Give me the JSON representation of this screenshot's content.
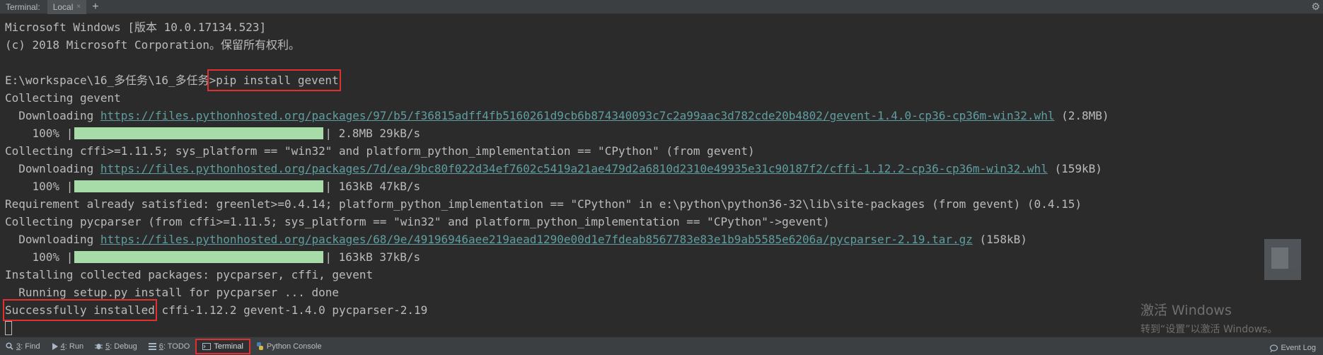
{
  "tabbar": {
    "label": "Terminal:",
    "tab_label": "Local",
    "close_glyph": "×",
    "add_glyph": "+",
    "gear_glyph": "⚙"
  },
  "terminal": {
    "lines": {
      "l1": "Microsoft Windows [版本 10.0.17134.523]",
      "l2": "(c) 2018 Microsoft Corporation。保留所有权利。",
      "prompt": "E:\\workspace\\16_多任务\\16_多任务",
      "command": ">pip install gevent",
      "l5": "Collecting gevent",
      "dl1_prefix": "  Downloading ",
      "dl1_url": "https://files.pythonhosted.org/packages/97/b5/f36815adff4fb5160261d9cb6b874340093c7c2a99aac3d782cde20b4802/gevent-1.4.0-cp36-cp36m-win32.whl",
      "dl1_size": " (2.8MB)",
      "p1_pct": "    100% |",
      "p1_rest": "| 2.8MB 29kB/s",
      "l8": "Collecting cffi>=1.11.5; sys_platform == \"win32\" and platform_python_implementation == \"CPython\" (from gevent)",
      "dl2_prefix": "  Downloading ",
      "dl2_url": "https://files.pythonhosted.org/packages/7d/ea/9bc80f022d34ef7602c5419a21ae479d2a6810d2310e49935e31c90187f2/cffi-1.12.2-cp36-cp36m-win32.whl",
      "dl2_size": " (159kB)",
      "p2_pct": "    100% |",
      "p2_rest": "| 163kB 47kB/s",
      "l11": "Requirement already satisfied: greenlet>=0.4.14; platform_python_implementation == \"CPython\" in e:\\python\\python36-32\\lib\\site-packages (from gevent) (0.4.15)",
      "l12": "Collecting pycparser (from cffi>=1.11.5; sys_platform == \"win32\" and platform_python_implementation == \"CPython\"->gevent)",
      "dl3_prefix": "  Downloading ",
      "dl3_url": "https://files.pythonhosted.org/packages/68/9e/49196946aee219aead1290e00d1e7fdeab8567783e83e1b9ab5585e6206a/pycparser-2.19.tar.gz",
      "dl3_size": " (158kB)",
      "p3_pct": "    100% |",
      "p3_rest": "| 163kB 37kB/s",
      "l15": "Installing collected packages: pycparser, cffi, gevent",
      "l16": "  Running setup.py install for pycparser ... done",
      "success": "Successfully installed",
      "success_rest": " cffi-1.12.2 gevent-1.4.0 pycparser-2.19"
    },
    "progress": [
      1.0,
      1.0,
      1.0
    ]
  },
  "watermark": {
    "line1": "激活 Windows",
    "line2": "转到“设置”以激活 Windows。"
  },
  "bottombar": {
    "find": {
      "num": "3",
      "label": ": Find",
      "icon": "search-icon"
    },
    "run": {
      "num": "4",
      "label": ": Run",
      "icon": "play-icon"
    },
    "debug": {
      "num": "5",
      "label": ": Debug",
      "icon": "bug-icon"
    },
    "todo": {
      "num": "6",
      "label": ": TODO",
      "icon": "list-icon"
    },
    "terminal": {
      "label": "Terminal",
      "icon": "terminal-icon"
    },
    "python_console": {
      "label": "Python Console",
      "icon": "python-icon"
    },
    "event_log": {
      "label": "Event Log",
      "icon": "speech-bubble-icon"
    }
  },
  "colors": {
    "background": "#2b2b2b",
    "text": "#bbbbbb",
    "link": "#5f9ea0",
    "progress_fill": "#a7dba7",
    "highlight_box": "#e03030"
  }
}
